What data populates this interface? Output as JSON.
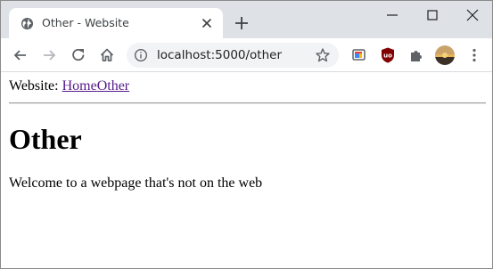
{
  "browser": {
    "tab": {
      "title": "Other - Website"
    },
    "address_bar": {
      "url": "localhost:5000/other"
    },
    "colors": {
      "tabstrip": "#dee1e6",
      "toolbar": "#ffffff",
      "omnibox": "#f1f3f4",
      "ublock": "#800000"
    }
  },
  "page": {
    "nav": {
      "prefix": "Website:",
      "links": [
        "Home",
        "Other"
      ]
    },
    "title": "Other",
    "body_text": "Welcome to a webpage that's not on the web",
    "colors": {
      "link": "#551a8b",
      "text": "#000000"
    }
  }
}
